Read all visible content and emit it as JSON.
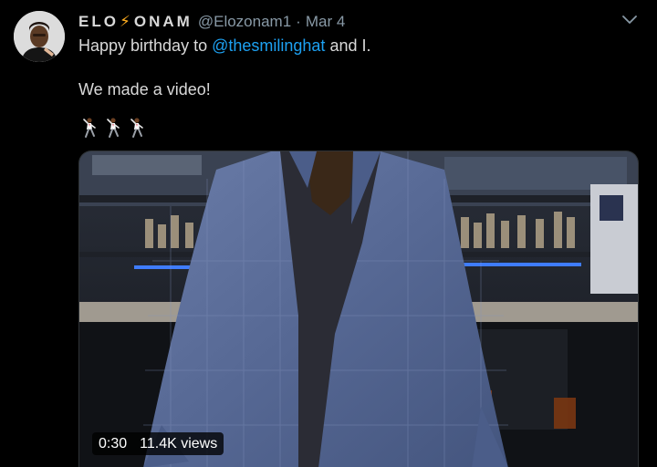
{
  "tweet": {
    "author_name_left": "ELO",
    "author_name_right": "ONAM",
    "handle": "@Elozonam1",
    "separator": "·",
    "date": "Mar 4",
    "text_prefix": "Happy birthday to ",
    "mention": "@thesmilinghat",
    "text_suffix": " and I.",
    "text_line2": "We made a video!",
    "emoji_count": 3,
    "emoji_name": "dancing-man-emoji"
  },
  "video": {
    "duration": "0:30",
    "views": "11.4K views"
  },
  "colors": {
    "background": "#000000",
    "text": "#d9d9d9",
    "secondary_text": "#8899a6",
    "link": "#1da1f2",
    "bolt": "#ffad1f"
  }
}
